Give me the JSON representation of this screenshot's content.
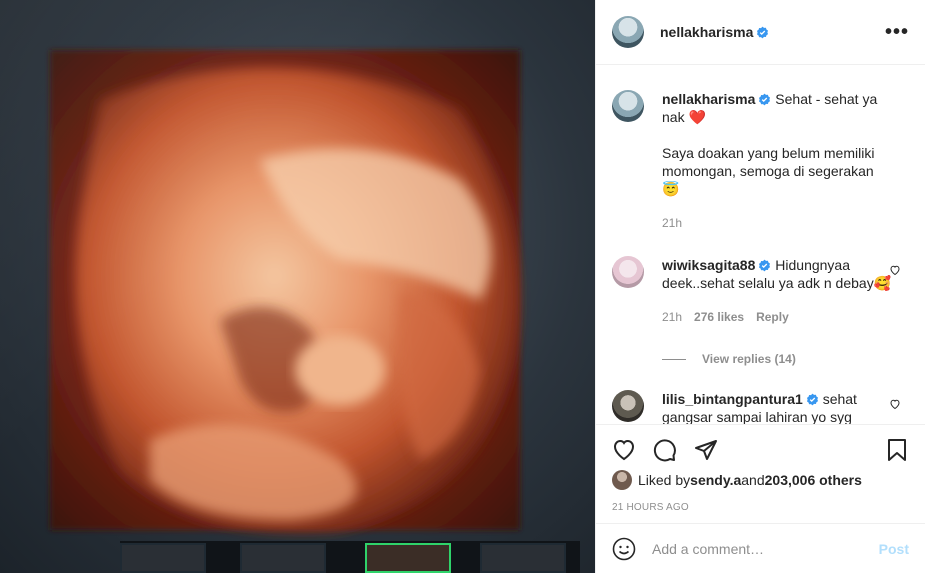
{
  "post": {
    "username": "nellakharisma",
    "verified": true,
    "caption_line1": "Sehat - sehat ya nak ❤️",
    "caption_line2": "Saya doakan yang belum memiliki momongan, semoga di segerakan 😇",
    "caption_time": "21h",
    "more_label": "•••"
  },
  "comments": [
    {
      "username": "wiwiksagita88",
      "verified": true,
      "text": "Hidungnyaa deek..sehat selalu ya adk n debay🥰",
      "time": "21h",
      "likes": "276 likes",
      "reply_label": "Reply",
      "view_replies": "View replies (14)"
    },
    {
      "username": "lilis_bintangpantura1",
      "verified": true,
      "text": "sehat gangsar sampai lahiran yo syg Aamiin😇"
    }
  ],
  "likes": {
    "prefix": "Liked by ",
    "user": "sendy.a",
    "middle": " and ",
    "count": "203,006 others"
  },
  "timestamp": "21 HOURS AGO",
  "add_comment": {
    "placeholder": "Add a comment…",
    "post_label": "Post"
  },
  "colors": {
    "verified": "#3897f0",
    "post_button_disabled": "#b2dffc",
    "thumb_active": "#2fd36a"
  },
  "icons": [
    "heart-icon",
    "comment-icon",
    "share-icon",
    "bookmark-icon",
    "emoji-icon",
    "verified-badge-icon",
    "more-options-icon"
  ]
}
